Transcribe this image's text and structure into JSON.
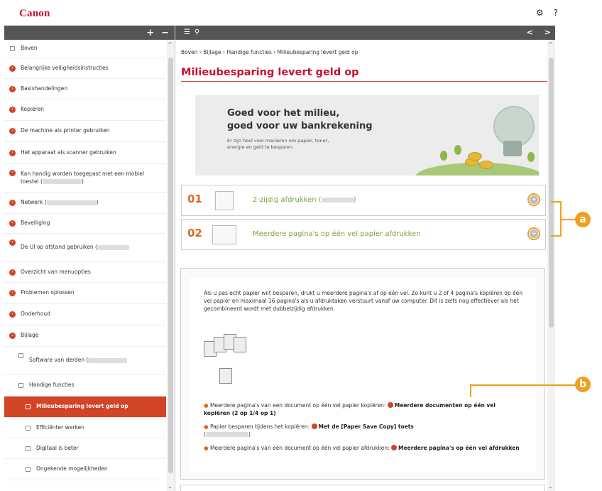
{
  "header": {
    "logo": "Canon",
    "settings_icon": "gear-icon",
    "help_label": "?"
  },
  "sidebar": {
    "expand_label": "+",
    "collapse_label": "−",
    "items": [
      {
        "label": "Boven",
        "type": "page"
      },
      {
        "label": "Belangrijke veiligheidsinstructies",
        "type": "chapter"
      },
      {
        "label": "Basishandelingen",
        "type": "chapter"
      },
      {
        "label": "Kopiëren",
        "type": "chapter"
      },
      {
        "label": "De machine als printer gebruiken",
        "type": "chapter"
      },
      {
        "label": "Het apparaat als scanner gebruiken",
        "type": "chapter"
      },
      {
        "label": "Kan handig worden toegepast met een mobiel toestel (",
        "label_end": ")",
        "type": "chapter"
      },
      {
        "label": "Netwerk (",
        "label_end": ")",
        "type": "chapter"
      },
      {
        "label": "Beveiliging",
        "type": "chapter"
      },
      {
        "label": "De UI op afstand gebruiken (",
        "type": "chapter"
      },
      {
        "label": "Overzicht van menuopties",
        "type": "chapter"
      },
      {
        "label": "Problemen oplossen",
        "type": "chapter"
      },
      {
        "label": "Onderhoud",
        "type": "chapter"
      },
      {
        "label": "Bijlage",
        "type": "chapter-open"
      },
      {
        "label": "Software van derden (",
        "type": "sub"
      },
      {
        "label": "Handige functies",
        "type": "sub-open"
      },
      {
        "label": "Milieubesparing levert geld op",
        "type": "subsub-active"
      },
      {
        "label": "Efficiënter werken",
        "type": "subsub"
      },
      {
        "label": "Digitaal is beter",
        "type": "subsub"
      },
      {
        "label": "Ongekende mogelijkheden",
        "type": "subsub"
      }
    ]
  },
  "toolbar": {
    "toc_icon": "list-icon",
    "search_icon": "search-icon",
    "prev_label": "<",
    "next_label": ">"
  },
  "main": {
    "breadcrumb": "Boven › Bijlage › Handige functies › Milieubesparing levert geld op",
    "title": "Milieubesparing levert geld op",
    "hero_heading_1": "Goed voor het milieu,",
    "hero_heading_2": "goed voor uw bankrekening",
    "hero_sub": "Er zijn heel veel manieren om papier, toner, energie en geld te besparen.",
    "features": [
      {
        "num": "01",
        "label": "2-zijdig afdrukken (",
        "label_end": ")"
      },
      {
        "num": "02",
        "label": "Meerdere pagina's op één vel papier afdrukken"
      }
    ],
    "paragraph": "Als u pas echt papier wilt besparen, drukt u meerdere pagina's af op één vel. Zo kunt u 2 of 4 pagina's kopiëren op één vel papier en maximaal 16 pagina's als u afdruktaken verstuurt vanaf uw computer. Dit is zelfs nog effectiever als het gecombineerd wordt met dubbelzijdig afdrukken.",
    "bullets": [
      {
        "text": "Meerdere pagina's van een document op één vel papier kopiëren: ",
        "link": "Meerdere documenten op één vel kopiëren (2 op 1/4 op 1)"
      },
      {
        "text": "Papier besparen tijdens het kopiëren: ",
        "link": "Met de [Paper Save Copy] toets",
        "text_end": "(",
        "text_end2": ")"
      },
      {
        "text": "Meerdere pagina's van een document op één vel papier afdrukken: ",
        "link": "Meerdere pagina's op één vel afdrukken"
      }
    ]
  },
  "callouts": {
    "a": "a",
    "b": "b"
  }
}
